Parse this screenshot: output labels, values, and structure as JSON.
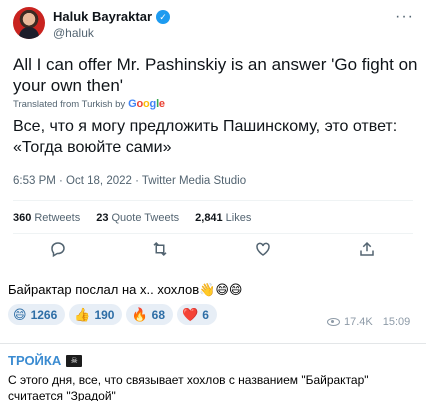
{
  "tweet": {
    "display_name": "Haluk Bayraktar",
    "handle": "@haluk",
    "text_en": "All I can offer Mr. Pashinskiy is an answer 'Go fight on your own then'",
    "translated_label": "Translated from Turkish by",
    "translator": "Google",
    "text_ru": "Все, что я могу предложить Пашинскому, это ответ: «Тогда воюйте сами»",
    "timestamp": "6:53 PM · Oct 18, 2022 · Twitter Media Studio",
    "stats": {
      "retweets_count": "360",
      "retweets_label": "Retweets",
      "quotes_count": "23",
      "quotes_label": "Quote Tweets",
      "likes_count": "2,841",
      "likes_label": "Likes"
    },
    "accent_color": "#1d9bf0"
  },
  "post": {
    "caption": "Байрактар послал на х.. хохлов👋😄😄",
    "reactions": [
      {
        "emoji": "😄",
        "count": "1266"
      },
      {
        "emoji": "👍",
        "count": "190"
      },
      {
        "emoji": "🔥",
        "count": "68"
      },
      {
        "emoji": "❤️",
        "count": "6"
      }
    ],
    "views": "17.4K",
    "time": "15:09"
  },
  "comment": {
    "author": "ТРОЙКА",
    "author_badge": "pirate-flag-icon",
    "text": "С этого дня, все, что связывает хохлов с названием \"Байрактар\" считается \"Зрадой\""
  }
}
